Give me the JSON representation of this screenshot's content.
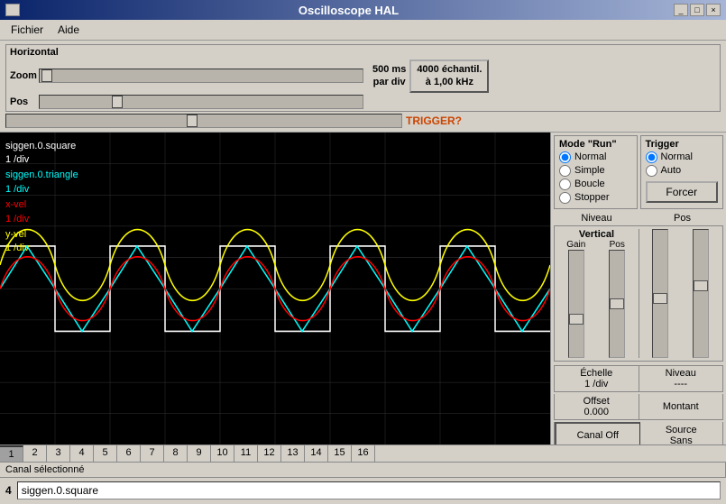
{
  "window": {
    "title": "Oscilloscope HAL",
    "controls": [
      "_",
      "□",
      "×"
    ]
  },
  "menu": {
    "items": [
      "Fichier",
      "Aide"
    ]
  },
  "horizontal": {
    "section_label": "Horizontal",
    "zoom_label": "Zoom",
    "pos_label": "Pos",
    "time_per_div": "500 ms\npar div",
    "sample_rate": "4000 échantil.\nà 1,00 kHz",
    "trigger_label": "TRIGGER?"
  },
  "mode_run": {
    "title": "Mode \"Run\"",
    "options": [
      "Normal",
      "Simple",
      "Boucle",
      "Stopper"
    ],
    "selected": "Normal"
  },
  "trigger": {
    "title": "Trigger",
    "options": [
      "Normal",
      "Auto"
    ],
    "selected": "Normal",
    "force_label": "Forcer",
    "niveau_label": "Niveau",
    "pos_label": "Pos"
  },
  "vertical": {
    "title": "Vertical",
    "gain_label": "Gain",
    "pos_label": "Pos"
  },
  "channel_info": {
    "echelle_label": "Échelle",
    "echelle_value": "1 /div",
    "offset_label": "Offset",
    "offset_value": "0.000",
    "canal_off_label": "Canal Off",
    "montant_label": "Montant",
    "source_label": "Source",
    "source_value": "Sans"
  },
  "channels": {
    "tabs": [
      "1",
      "2",
      "3",
      "4",
      "5",
      "6",
      "7",
      "8",
      "9",
      "10",
      "11",
      "12",
      "13",
      "14",
      "15",
      "16"
    ],
    "active": "1",
    "selected_label": "Canal sélectionné",
    "channel_num": "4",
    "signal_name": "siggen.0.square"
  },
  "waveforms": [
    {
      "label": "siggen.0.square",
      "sub": "1 /div",
      "color": "white"
    },
    {
      "label": "siggen.0.triangle",
      "sub": "1 /div",
      "color": "cyan"
    },
    {
      "label": "x-vel",
      "sub": "1 /div",
      "color": "red"
    },
    {
      "label": "y-vel",
      "sub": "1 /div",
      "color": "yellow"
    }
  ]
}
